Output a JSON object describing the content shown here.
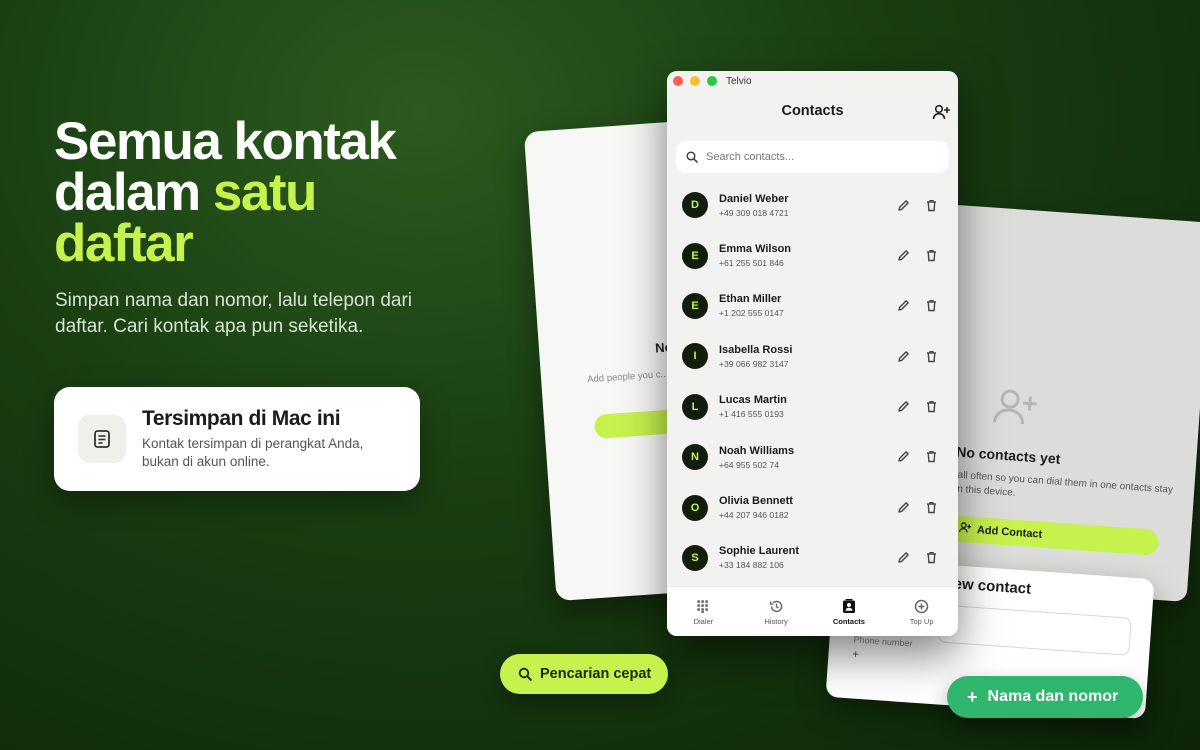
{
  "hero": {
    "headline_line1": "Semua kontak",
    "headline_line2_pre": "dalam ",
    "headline_line2_accent": "satu",
    "headline_line3_accent": "daftar",
    "subhead": "Simpan nama dan nomor, lalu telepon dari daftar. Cari kontak apa pun seketika.",
    "accent_color": "#c6f24e"
  },
  "info_card": {
    "icon": "document-icon",
    "title": "Tersimpan di Mac ini",
    "description": "Kontak tersimpan di perangkat Anda, bukan di akun online."
  },
  "back_left_card": {
    "title": "No",
    "text": "Add people you c... tap. Co"
  },
  "back_right_card": {
    "title": "No contacts yet",
    "text": "call often so you can dial them in one ontacts stay on this device.",
    "button_label": "Add Contact"
  },
  "new_contact_card": {
    "title": "ew contact",
    "phone_label": "Phone number",
    "plus": "+"
  },
  "window": {
    "app_name": "Telvio",
    "title": "Contacts",
    "search_placeholder": "Search contacts...",
    "contacts": [
      {
        "initial": "D",
        "name": "Daniel Weber",
        "phone": "+49 309 018 4721"
      },
      {
        "initial": "E",
        "name": "Emma Wilson",
        "phone": "+61 255 501 846"
      },
      {
        "initial": "E",
        "name": "Ethan Miller",
        "phone": "+1 202 555 0147"
      },
      {
        "initial": "I",
        "name": "Isabella Rossi",
        "phone": "+39 066 982 3147"
      },
      {
        "initial": "L",
        "name": "Lucas Martin",
        "phone": "+1 416 555 0193"
      },
      {
        "initial": "N",
        "name": "Noah Williams",
        "phone": "+64 955 502 74"
      },
      {
        "initial": "O",
        "name": "Olivia Bennett",
        "phone": "+44 207 946 0182"
      },
      {
        "initial": "S",
        "name": "Sophie Laurent",
        "phone": "+33 184 882 106"
      }
    ],
    "tabs": [
      {
        "label": "Dialer",
        "icon": "dialpad-icon"
      },
      {
        "label": "History",
        "icon": "history-icon"
      },
      {
        "label": "Contacts",
        "icon": "contacts-icon",
        "active": true
      },
      {
        "label": "Top Up",
        "icon": "plus-circle-icon"
      }
    ]
  },
  "pills": {
    "search_label": "Pencarian cepat",
    "name_label": "Nama dan nomor",
    "name_plus": "+"
  }
}
